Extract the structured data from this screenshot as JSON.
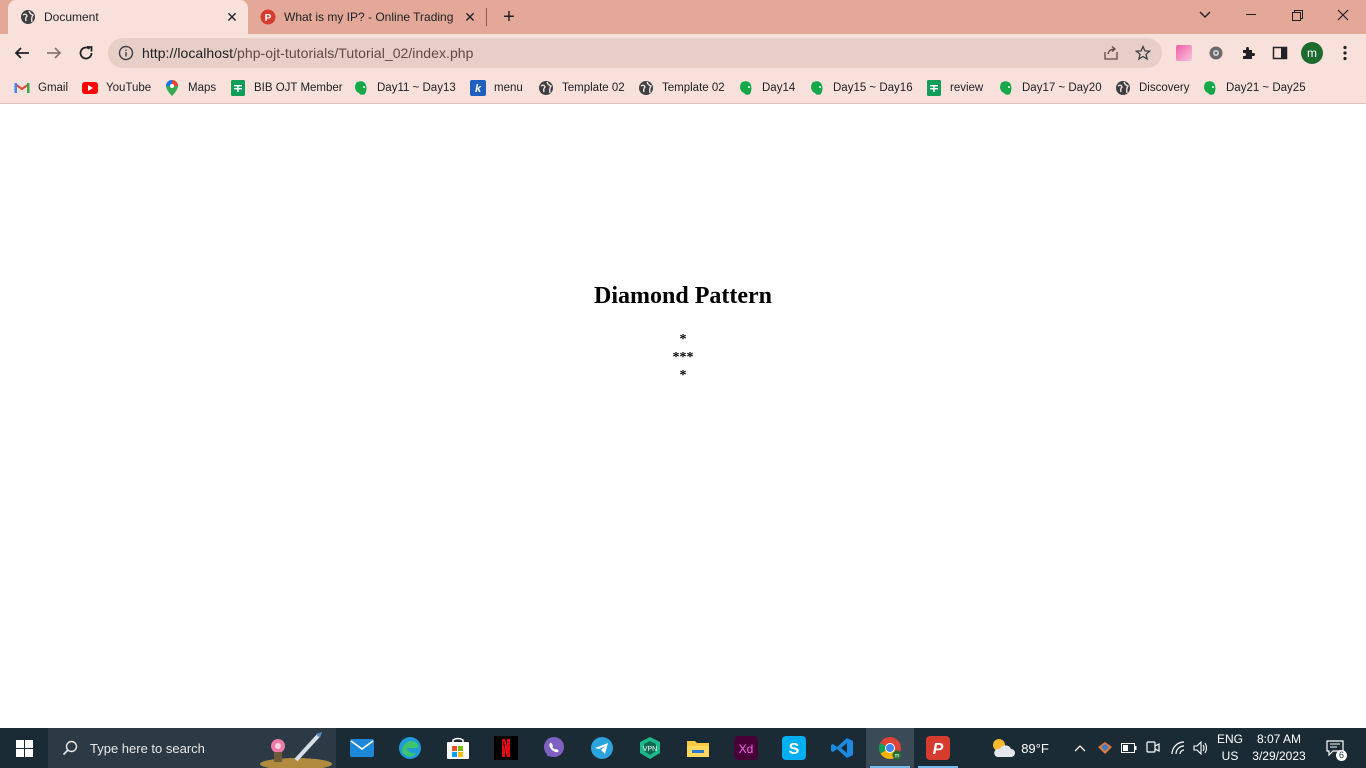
{
  "browser": {
    "tabs": [
      {
        "title": "Document",
        "active": true,
        "favicon": "globe-icon"
      },
      {
        "title": "What is my IP? - Online Trading",
        "active": false,
        "favicon": "psiphon-icon"
      }
    ],
    "new_tab_icon": "plus-icon",
    "url_host": "http://localhost",
    "url_path": "/php-ojt-tutorials/Tutorial_02/index.php",
    "profile_initial": "m",
    "accent": "#e3a898"
  },
  "bookmarks": [
    {
      "label": "Gmail",
      "icon": "gmail-icon"
    },
    {
      "label": "YouTube",
      "icon": "youtube-icon"
    },
    {
      "label": "Maps",
      "icon": "maps-icon"
    },
    {
      "label": "BIB OJT Member",
      "icon": "sheets-icon"
    },
    {
      "label": "Day11 ~ Day13",
      "icon": "evernote-icon"
    },
    {
      "label": "menu",
      "icon": "k-icon"
    },
    {
      "label": "Template 02",
      "icon": "globe-icon"
    },
    {
      "label": "Template 02",
      "icon": "globe-icon"
    },
    {
      "label": "Day14",
      "icon": "evernote-icon"
    },
    {
      "label": "Day15 ~ Day16",
      "icon": "evernote-icon"
    },
    {
      "label": "review",
      "icon": "sheets-icon"
    },
    {
      "label": "Day17 ~ Day20",
      "icon": "evernote-icon"
    },
    {
      "label": "Discovery",
      "icon": "globe-icon"
    },
    {
      "label": "Day21 ~ Day25",
      "icon": "evernote-icon"
    }
  ],
  "page": {
    "heading": "Diamond Pattern",
    "pattern_lines": [
      "*",
      "***",
      "*"
    ]
  },
  "taskbar": {
    "search_placeholder": "Type here to search",
    "weather": "89°F",
    "language": "ENG",
    "region": "US",
    "time": "8:07 AM",
    "date": "3/29/2023",
    "notifications": "6"
  }
}
